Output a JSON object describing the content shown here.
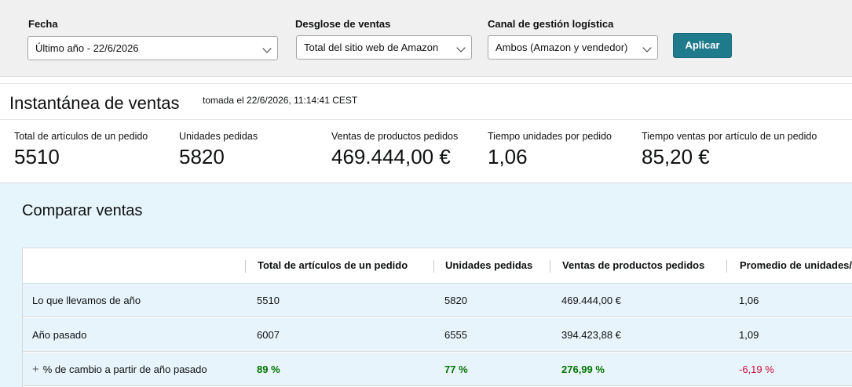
{
  "filters": {
    "date": {
      "label": "Fecha",
      "value": "Último año - 22/6/2026"
    },
    "breakdown": {
      "label": "Desglose de ventas",
      "value": "Total del sitio web de Amazon"
    },
    "channel": {
      "label": "Canal de gestión logística",
      "value": "Ambos (Amazon y vendedor)"
    },
    "apply_label": "Aplicar"
  },
  "snapshot": {
    "title": "Instantánea de ventas",
    "taken": "tomada el 22/6/2026, 11:14:41 CEST",
    "metrics": [
      {
        "label": "Total de artículos de un pedido",
        "value": "5510"
      },
      {
        "label": "Unidades pedidas",
        "value": "5820"
      },
      {
        "label": "Ventas de productos pedidos",
        "value": "469.444,00 €"
      },
      {
        "label": "Tiempo unidades por pedido",
        "value": "1,06"
      },
      {
        "label": "Tiempo ventas por artículo de un pedido",
        "value": "85,20 €"
      }
    ]
  },
  "compare": {
    "title": "Comparar ventas",
    "columns": [
      "",
      "Total de artículos de un pedido",
      "Unidades pedidas",
      "Ventas de productos pedidos",
      "Promedio de unidades/"
    ],
    "rows": [
      {
        "label": "Lo que llevamos de año",
        "cells": [
          "5510",
          "5820",
          "469.444,00 €",
          "1,06"
        ]
      },
      {
        "label": "Año pasado",
        "cells": [
          "6007",
          "6555",
          "394.423,88 €",
          "1,09"
        ]
      },
      {
        "label": "% de cambio a partir de año pasado",
        "cells": [
          "89 %",
          "77 %",
          "276,99 %",
          "-6,19 %"
        ]
      }
    ],
    "plus_glyph": "+"
  },
  "colors": {
    "accent": "#1f7a8c",
    "positive": "#007600",
    "negative": "#cc0c39",
    "compare_bg": "#e6f4fb"
  }
}
